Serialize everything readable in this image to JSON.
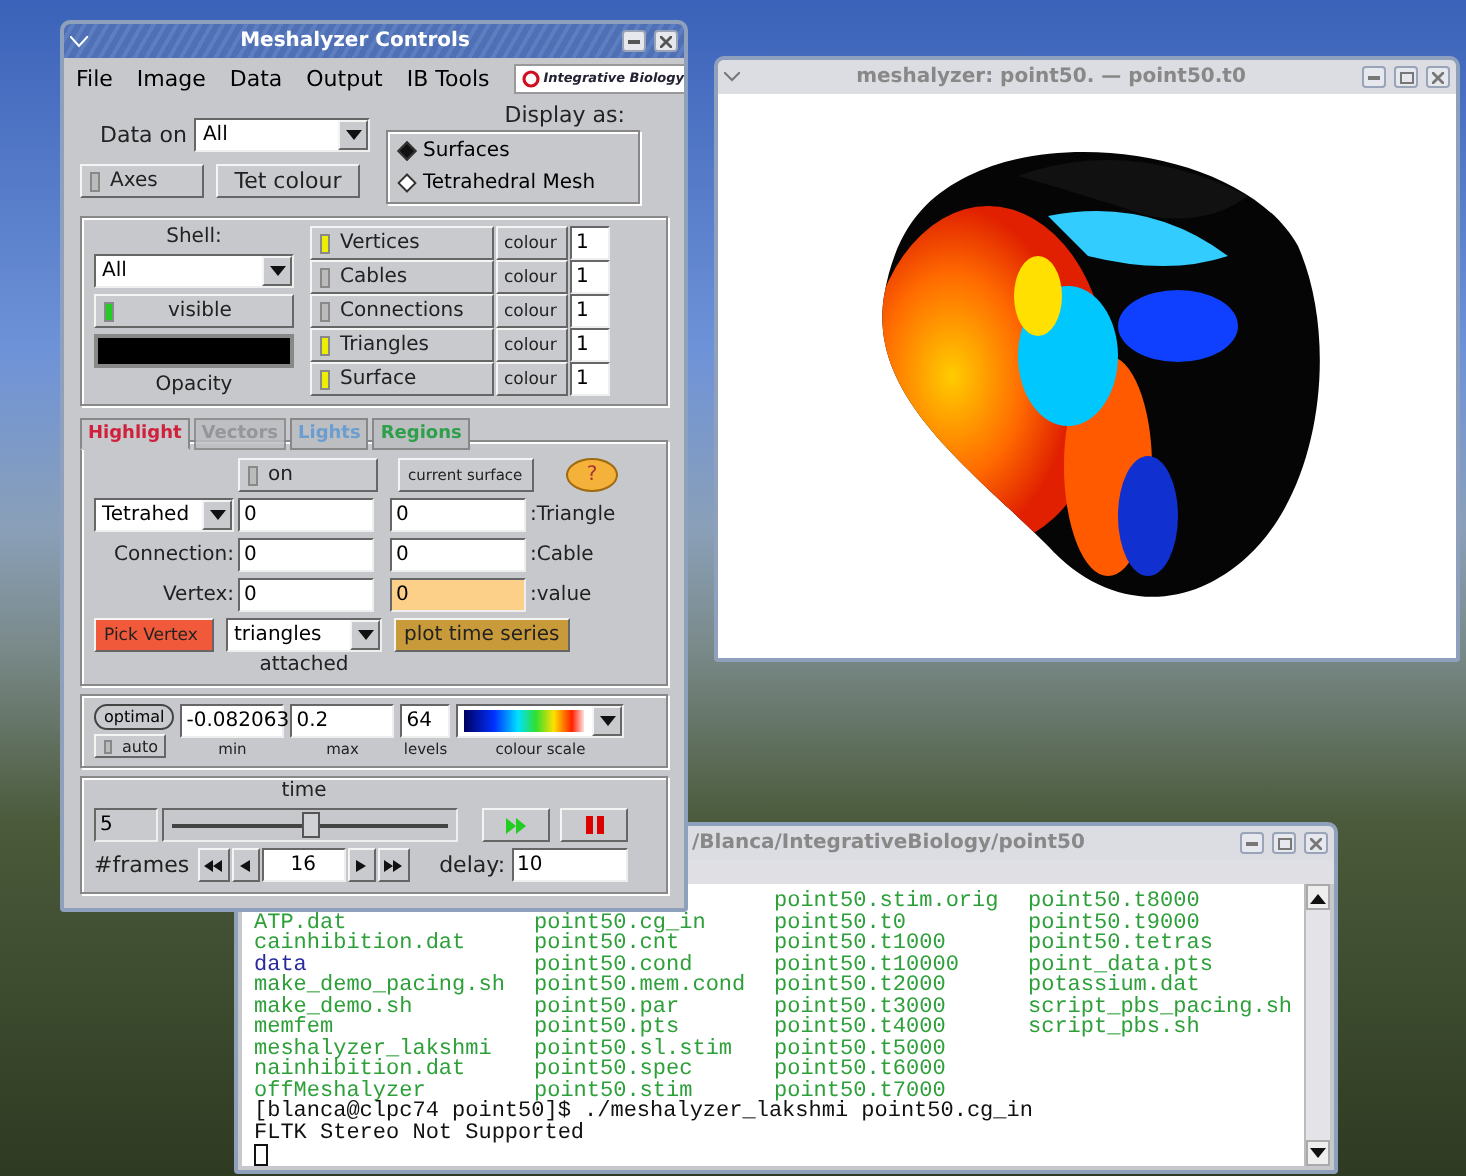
{
  "controls_window": {
    "title": "Meshalyzer Controls",
    "menu": [
      "File",
      "Image",
      "Data",
      "Output",
      "IB Tools"
    ],
    "logo": "Integrative Biology",
    "data_on": {
      "label": "Data on",
      "value": "All"
    },
    "axes": {
      "label": "Axes",
      "on": false
    },
    "tet_colour": "Tet colour",
    "display_as": {
      "label": "Display as:",
      "options": [
        {
          "label": "Surfaces",
          "selected": true
        },
        {
          "label": "Tetrahedral Mesh",
          "selected": false
        }
      ]
    },
    "shell": {
      "label": "Shell:",
      "value": "All",
      "visible": {
        "label": "visible",
        "on": true
      },
      "opacity_label": "Opacity"
    },
    "elements": [
      {
        "label": "Vertices",
        "on": true,
        "colour_button": "colour",
        "value": "1"
      },
      {
        "label": "Cables",
        "on": false,
        "colour_button": "colour",
        "value": "1"
      },
      {
        "label": "Connections",
        "on": false,
        "colour_button": "colour",
        "value": "1"
      },
      {
        "label": "Triangles",
        "on": true,
        "colour_button": "colour",
        "value": "1"
      },
      {
        "label": "Surface",
        "on": true,
        "colour_button": "colour",
        "value": "1"
      }
    ],
    "tabs": [
      {
        "label": "Highlight",
        "selected": true,
        "disabled": false,
        "color": "#d0203c"
      },
      {
        "label": "Vectors",
        "selected": false,
        "disabled": true,
        "color": "#8e8e92"
      },
      {
        "label": "Lights",
        "selected": false,
        "disabled": false,
        "color": "#6a9ed0"
      },
      {
        "label": "Regions",
        "selected": false,
        "disabled": false,
        "color": "#2ea04a"
      }
    ],
    "highlight": {
      "on": {
        "label": "on",
        "on": false
      },
      "current_surface": "current surface",
      "help": "?",
      "rows": [
        {
          "kind": "select",
          "select": "Tetrahed",
          "left_value": "0",
          "right_value": "0",
          "right_highlighted": false,
          "right_label": ":Triangle"
        },
        {
          "kind": "label",
          "label": "Connection:",
          "left_value": "0",
          "right_value": "0",
          "right_highlighted": false,
          "right_label": ":Cable"
        },
        {
          "kind": "label",
          "label": "Vertex:",
          "left_value": "0",
          "right_value": "0",
          "right_highlighted": true,
          "right_label": ":value"
        }
      ],
      "pick_vertex": "Pick Vertex",
      "attached_select": "triangles",
      "attached_label": "attached",
      "plot_time_series": "plot time series"
    },
    "scale": {
      "optimal": "optimal",
      "auto": {
        "label": "auto",
        "on": false
      },
      "fields": [
        {
          "value": "-0.082063",
          "label": "min"
        },
        {
          "value": "0.2",
          "label": "max"
        },
        {
          "value": "64",
          "label": "levels"
        }
      ],
      "colour_scale_label": "colour scale"
    },
    "time": {
      "label": "time",
      "value": "5",
      "level": 0.5,
      "frames_label": "#frames",
      "frames": "16",
      "delay_label": "delay:",
      "delay": "10"
    }
  },
  "viewer_window": {
    "title": "meshalyzer: point50. — point50.t0"
  },
  "terminal_window": {
    "title": "/Blanca/IntegrativeBiology/point50",
    "rows": [
      [
        null,
        null,
        {
          "text": "point50.stim.orig",
          "kind": "file"
        },
        {
          "text": "point50.t8000",
          "kind": "file"
        }
      ],
      [
        {
          "text": "ATP.dat",
          "kind": "file"
        },
        {
          "text": "point50.cg_in",
          "kind": "file"
        },
        {
          "text": "point50.t0",
          "kind": "file"
        },
        {
          "text": "point50.t9000",
          "kind": "file"
        }
      ],
      [
        {
          "text": "cainhibition.dat",
          "kind": "file"
        },
        {
          "text": "point50.cnt",
          "kind": "file"
        },
        {
          "text": "point50.t1000",
          "kind": "file"
        },
        {
          "text": "point50.tetras",
          "kind": "file"
        }
      ],
      [
        {
          "text": "data",
          "kind": "dir"
        },
        {
          "text": "point50.cond",
          "kind": "file"
        },
        {
          "text": "point50.t10000",
          "kind": "file"
        },
        {
          "text": "point_data.pts",
          "kind": "file"
        }
      ],
      [
        {
          "text": "make_demo_pacing.sh",
          "kind": "file"
        },
        {
          "text": "point50.mem.cond",
          "kind": "file"
        },
        {
          "text": "point50.t2000",
          "kind": "file"
        },
        {
          "text": "potassium.dat",
          "kind": "file"
        }
      ],
      [
        {
          "text": "make_demo.sh",
          "kind": "file"
        },
        {
          "text": "point50.par",
          "kind": "file"
        },
        {
          "text": "point50.t3000",
          "kind": "file"
        },
        {
          "text": "script_pbs_pacing.sh",
          "kind": "file"
        }
      ],
      [
        {
          "text": "memfem",
          "kind": "file"
        },
        {
          "text": "point50.pts",
          "kind": "file"
        },
        {
          "text": "point50.t4000",
          "kind": "file"
        },
        {
          "text": "script_pbs.sh",
          "kind": "file"
        }
      ],
      [
        {
          "text": "meshalyzer_lakshmi",
          "kind": "file"
        },
        {
          "text": "point50.sl.stim",
          "kind": "file"
        },
        {
          "text": "point50.t5000",
          "kind": "file"
        },
        null
      ],
      [
        {
          "text": "nainhibition.dat",
          "kind": "file"
        },
        {
          "text": "point50.spec",
          "kind": "file"
        },
        {
          "text": "point50.t6000",
          "kind": "file"
        },
        null
      ],
      [
        {
          "text": "offMeshalyzer",
          "kind": "file"
        },
        {
          "text": "point50.stim",
          "kind": "file"
        },
        {
          "text": "point50.t7000",
          "kind": "file"
        },
        null
      ]
    ],
    "lines": [
      "[blanca@clpc74 point50]$ ./meshalyzer_lakshmi point50.cg_in",
      "FLTK Stereo Not Supported"
    ]
  }
}
